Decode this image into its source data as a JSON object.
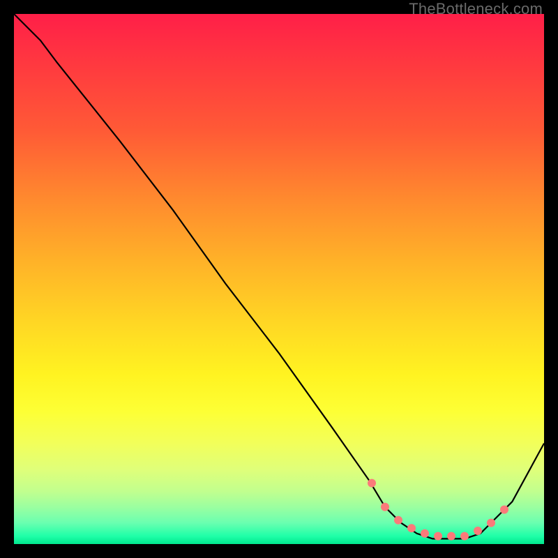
{
  "watermark": "TheBottleneck.com",
  "palette": {
    "curve_stroke": "#000000",
    "marker_fill": "#fb7a7a",
    "marker_stroke": "#c94e4e"
  },
  "chart_data": {
    "type": "line",
    "title": "",
    "xlabel": "",
    "ylabel": "",
    "xlim": [
      0,
      100
    ],
    "ylim": [
      0,
      100
    ],
    "grid": false,
    "legend": false,
    "series": [
      {
        "name": "bottleneck-curve",
        "x": [
          0,
          5,
          8,
          12,
          20,
          30,
          40,
          50,
          60,
          67,
          70,
          73,
          76,
          79,
          82,
          85,
          88,
          90,
          94,
          100
        ],
        "values": [
          100,
          95,
          91,
          86,
          76,
          63,
          49,
          36,
          22,
          12,
          7,
          4,
          2,
          1,
          1,
          1,
          2,
          4,
          8,
          19
        ]
      }
    ],
    "markers": {
      "name": "highlight-points",
      "x": [
        67.5,
        70,
        72.5,
        75,
        77.5,
        80,
        82.5,
        85,
        87.5,
        90,
        92.5
      ],
      "values": [
        11.5,
        7,
        4.5,
        3,
        2,
        1.5,
        1.5,
        1.5,
        2.5,
        4,
        6.5
      ]
    }
  }
}
